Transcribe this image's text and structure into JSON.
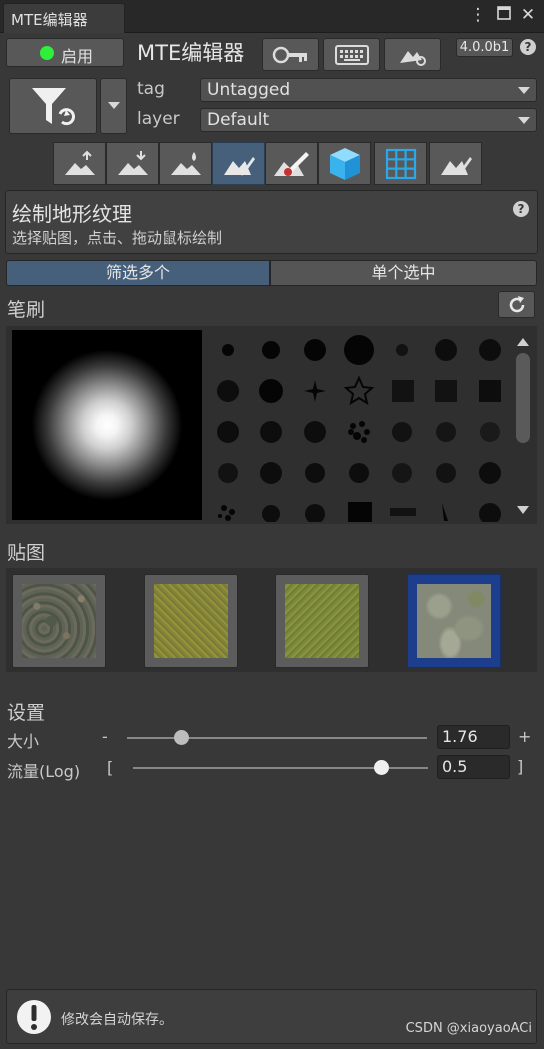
{
  "window": {
    "tab_title": "MTE编辑器",
    "menu_icon": "kebab-menu-icon",
    "maximize_icon": "maximize-icon",
    "close_icon": "close-icon"
  },
  "header": {
    "enable_label": "启用",
    "enable_status_color": "#2ef03a",
    "title": "MTE编辑器",
    "version": "4.0.0b1",
    "help": "?",
    "icons": [
      "key-icon",
      "keyboard-icon",
      "terrain-settings-icon"
    ]
  },
  "filter": {
    "icon": "filter-refresh-icon",
    "tag_label": "tag",
    "tag_value": "Untagged",
    "layer_label": "layer",
    "layer_value": "Default"
  },
  "tools": {
    "active_index": 3,
    "items": [
      "raise-terrain-icon",
      "lower-terrain-icon",
      "smooth-terrain-icon",
      "paint-texture-icon",
      "paint-brush-icon",
      "cube-icon",
      "grid-icon",
      "paint-alt-icon"
    ]
  },
  "description": {
    "title": "绘制地形纹理",
    "text": "选择贴图，点击、拖动鼠标绘制",
    "help": "?"
  },
  "mode": {
    "multi": "筛选多个",
    "single": "单个选中",
    "active": "multi"
  },
  "brush": {
    "section_label": "笔刷",
    "refresh_icon": "refresh-icon",
    "scroll_up_icon": "triangle-up-icon",
    "scroll_down_icon": "triangle-down-icon"
  },
  "texture": {
    "section_label": "贴图",
    "selected_index": 3,
    "items": [
      "rocky-gravel-texture",
      "grass-texture",
      "grass-texture",
      "stone-texture"
    ]
  },
  "settings": {
    "section_label": "设置",
    "size_label": "大小",
    "size_minus": "-",
    "size_plus": "+",
    "size_value": "1.76",
    "size_fraction": 0.18,
    "flow_label": "流量(Log)",
    "flow_left": "[",
    "flow_right": "]",
    "flow_value": "0.5",
    "flow_fraction": 0.84
  },
  "footer": {
    "icon": "exclamation-icon",
    "text": "修改会自动保存。",
    "watermark": "CSDN @xiaoyaoACi"
  }
}
